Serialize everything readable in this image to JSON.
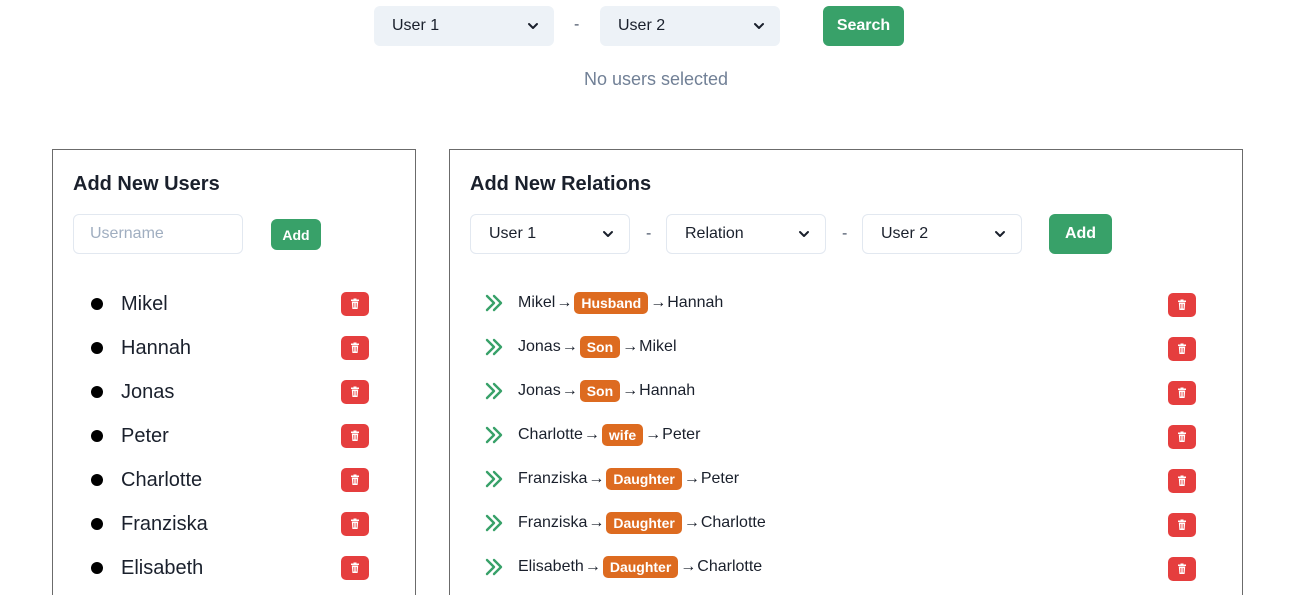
{
  "search": {
    "user1_select": "User 1",
    "separator": "-",
    "user2_select": "User 2",
    "button": "Search",
    "status": "No users selected"
  },
  "users_panel": {
    "title": "Add New Users",
    "username_placeholder": "Username",
    "add_button": "Add",
    "users": [
      "Mikel",
      "Hannah",
      "Jonas",
      "Peter",
      "Charlotte",
      "Franziska",
      "Elisabeth"
    ]
  },
  "relations_panel": {
    "title": "Add New Relations",
    "user1_select": "User 1",
    "relation_select": "Relation",
    "user2_select": "User 2",
    "separator": "-",
    "add_button": "Add",
    "relations": [
      {
        "from": "Mikel",
        "relation": "Husband",
        "to": "Hannah"
      },
      {
        "from": "Jonas",
        "relation": "Son",
        "to": "Mikel"
      },
      {
        "from": "Jonas",
        "relation": "Son",
        "to": "Hannah"
      },
      {
        "from": "Charlotte",
        "relation": "wife",
        "to": "Peter"
      },
      {
        "from": "Franziska",
        "relation": "Daughter",
        "to": "Peter"
      },
      {
        "from": "Franziska",
        "relation": "Daughter",
        "to": "Charlotte"
      },
      {
        "from": "Elisabeth",
        "relation": "Daughter",
        "to": "Charlotte"
      }
    ]
  },
  "colors": {
    "accent_green": "#38a169",
    "delete_red": "#e53e3e",
    "badge_orange": "#dd6b20"
  },
  "icons": {
    "relation": "double-chevron-right-icon",
    "delete": "trash-icon",
    "dropdown": "chevron-down-icon"
  }
}
